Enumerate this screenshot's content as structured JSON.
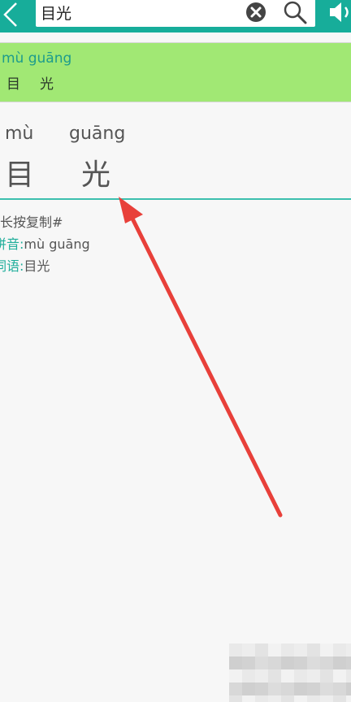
{
  "search": {
    "value": "目光"
  },
  "suggestion": {
    "pinyin": "mù guāng",
    "chars": [
      "目",
      "光"
    ]
  },
  "entry": {
    "syllables": [
      {
        "pinyin": "mù",
        "char": "目"
      },
      {
        "pinyin": "guāng",
        "char": "光"
      }
    ],
    "copy_hint": "长按复制#",
    "pinyin_label": "拼音:",
    "pinyin_value": "mù guāng",
    "word_label": "词语:",
    "word_value": "目光"
  },
  "icons": {
    "back": "back-chevron-icon",
    "clear": "clear-circle-icon",
    "search": "magnifier-icon",
    "speaker": "speaker-icon"
  },
  "colors": {
    "header": "#17ad9a",
    "suggestion_bg": "#a1e874",
    "accent": "#1fae9b",
    "arrow": "#e8403a"
  }
}
